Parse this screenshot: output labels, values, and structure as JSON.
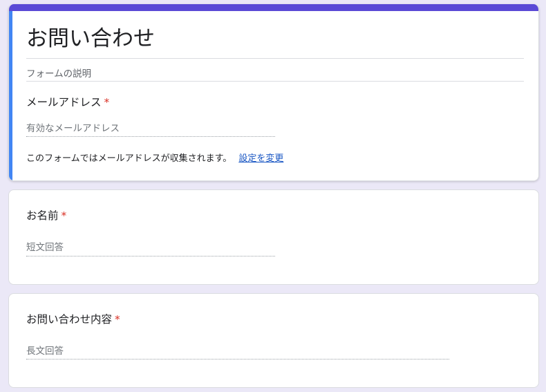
{
  "header": {
    "title": "お問い合わせ",
    "description_placeholder": "フォームの説明",
    "email_question": {
      "label": "メールアドレス",
      "required_mark": "*",
      "placeholder": "有効なメールアドレス"
    },
    "collect_note": "このフォームではメールアドレスが収集されます。",
    "settings_link": "設定を変更"
  },
  "questions": [
    {
      "label": "お名前",
      "required_mark": "*",
      "answer_placeholder": "短文回答"
    },
    {
      "label": "お問い合わせ内容",
      "required_mark": "*",
      "answer_placeholder": "長文回答"
    }
  ],
  "colors": {
    "background": "#ebe8f7",
    "theme_strip": "#5a49d6",
    "focus_accent": "#4285f4",
    "required": "#d93025",
    "link": "#1a57c4"
  }
}
